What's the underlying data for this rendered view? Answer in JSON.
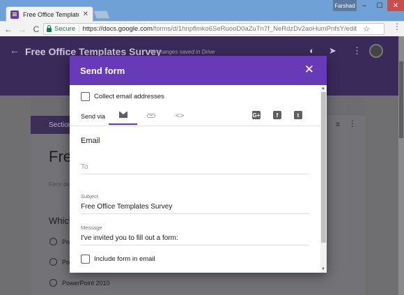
{
  "browser": {
    "tab_title": "Free Office Templates Su",
    "tab_close": "✕",
    "user_name": "Farshad",
    "window_controls": [
      "–",
      "☐",
      "✕"
    ],
    "nav": {
      "back": "←",
      "forward": "→",
      "reload": "C"
    },
    "security_label": "Secure",
    "url_host": "https://docs.google.com",
    "url_path": "/forms/d/1hnpflmko6SeRuooD0aZuTn7f_NeRdzDv2aoHumPnfsY/edit",
    "star": "☆",
    "menu": "⋮"
  },
  "forms_header": {
    "back_arrow": "←",
    "title": "Free Office Templates Survey",
    "saved_status": "All changes saved in Drive"
  },
  "form_background": {
    "section_label": "Section",
    "form_title": "Free",
    "form_description": "Form de",
    "question": "Which",
    "options": [
      "Po",
      "Po",
      "PowerPoint 2010"
    ]
  },
  "dialog": {
    "title": "Send form",
    "close": "✕",
    "collect_emails_label": "Collect email addresses",
    "send_via_label": "Send via",
    "send_via_code": "<>",
    "social": {
      "google_plus": "G+",
      "facebook": "f",
      "twitter": "t"
    },
    "email_section_title": "Email",
    "to_placeholder": "To",
    "subject_label": "Subject",
    "subject_value": "Free Office Templates Survey",
    "message_label": "Message",
    "message_value": "I've invited you to fill out a form:",
    "include_form_label": "Include form in email"
  }
}
